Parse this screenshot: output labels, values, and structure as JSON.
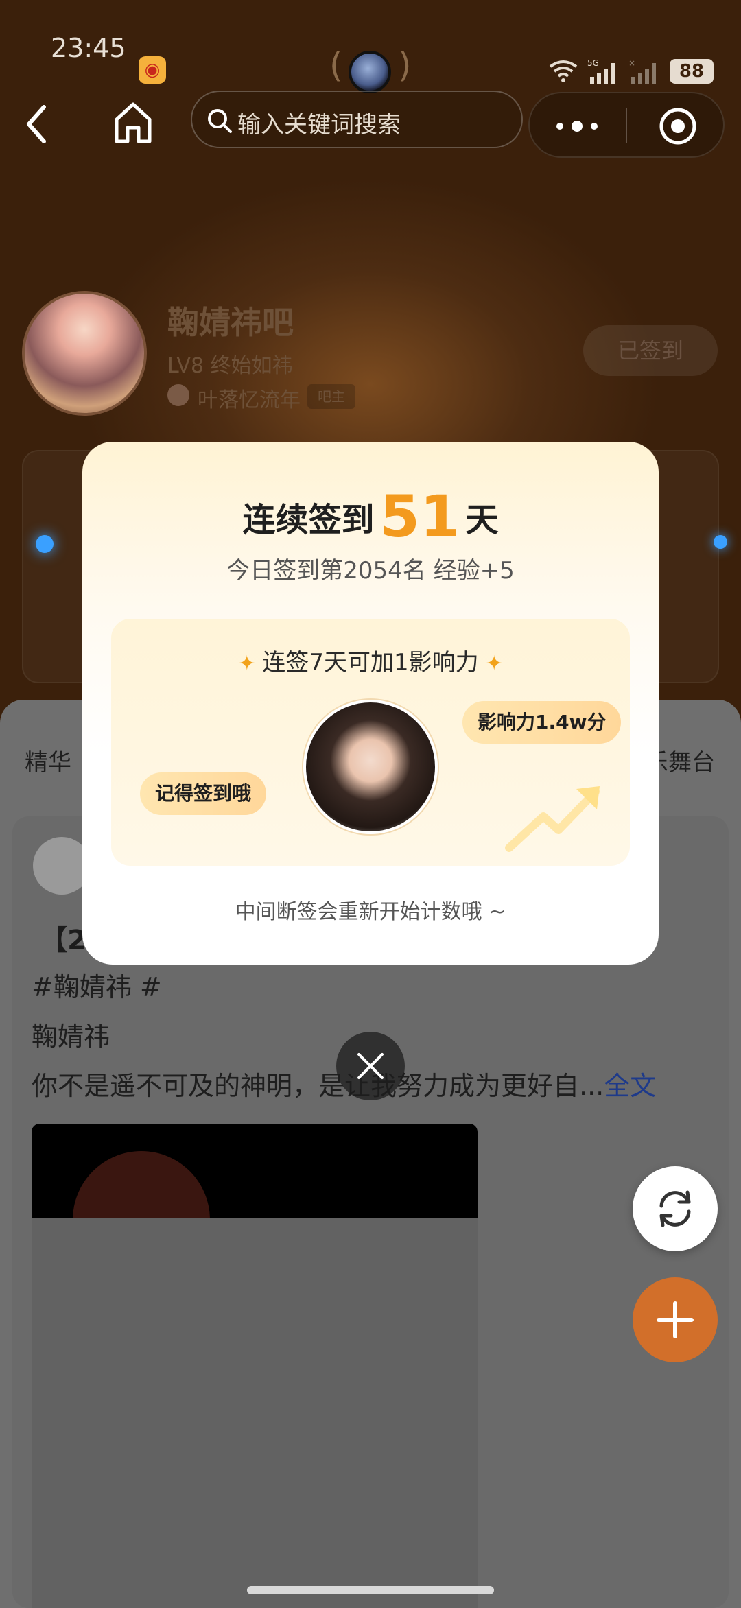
{
  "status_bar": {
    "time": "23:45",
    "network": "5G",
    "battery": "88"
  },
  "nav": {
    "search_placeholder": "输入关键词搜索"
  },
  "forum": {
    "name": "鞠婧祎吧",
    "level": "LV8 终始如祎",
    "owner_name": "叶落忆流年",
    "owner_badge": "吧主",
    "signed_label": "已签到"
  },
  "tabs": {
    "left": "精华",
    "right": "乐舞台"
  },
  "post": {
    "title_fragment": "【20",
    "lines": [
      "#鞠婧祎 #",
      "鞠婧祎",
      "你不是遥不可及的神明，是让我努力成为更好自"
    ],
    "ellipsis": "...",
    "more_label": "全文"
  },
  "modal": {
    "title_prefix": "连续签到",
    "streak_days": "51",
    "title_suffix": "天",
    "subtitle": "今日签到第2054名 经验+5",
    "promo_title": "连签7天可加1影响力",
    "bubble_left": "记得签到哦",
    "bubble_right": "影响力1.4w分",
    "footer": "中间断签会重新开始计数哦 ~"
  },
  "colors": {
    "accent_orange": "#f39a1e",
    "add_button": "#d26f2a",
    "header_brown": "#4d2c12"
  },
  "icons": [
    "back-icon",
    "home-icon",
    "search-icon",
    "more-icon",
    "target-icon",
    "close-icon",
    "refresh-icon",
    "plus-icon",
    "trend-arrow-icon",
    "sparkle-icon"
  ]
}
